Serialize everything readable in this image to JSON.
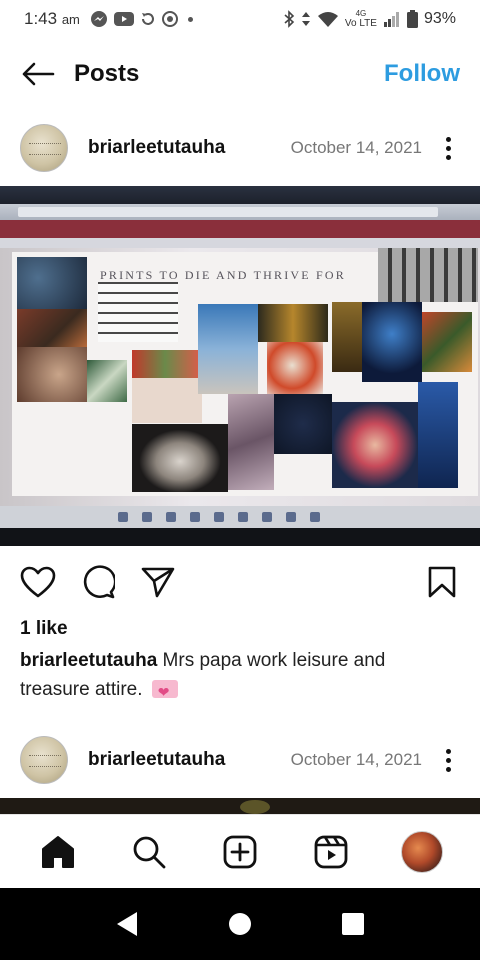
{
  "status_bar": {
    "time": "1:43",
    "ampm": "am",
    "battery": "93%",
    "network": "Vo LTE",
    "network_gen": "4G"
  },
  "header": {
    "title": "Posts",
    "follow_label": "Follow"
  },
  "post": {
    "username": "briarleetutauha",
    "date": "October 14, 2021",
    "image_slide_title": "PRINTS TO DIE AND THRIVE FOR",
    "likes": "1 like",
    "caption_user": "briarleetutauha",
    "caption_text": "Mrs papa work leisure and treasure attire."
  },
  "next_post": {
    "username": "briarleetutauha",
    "date": "October 14, 2021"
  },
  "icons": {
    "back": "arrow-left-icon",
    "more": "more-vertical-icon",
    "like": "heart-icon",
    "comment": "comment-icon",
    "share": "send-icon",
    "save": "bookmark-icon",
    "nav_home": "home-icon",
    "nav_search": "search-icon",
    "nav_create": "add-post-icon",
    "nav_reels": "reels-icon"
  },
  "colors": {
    "accent": "#2d9ce0",
    "text": "#111111",
    "muted": "#777777"
  }
}
